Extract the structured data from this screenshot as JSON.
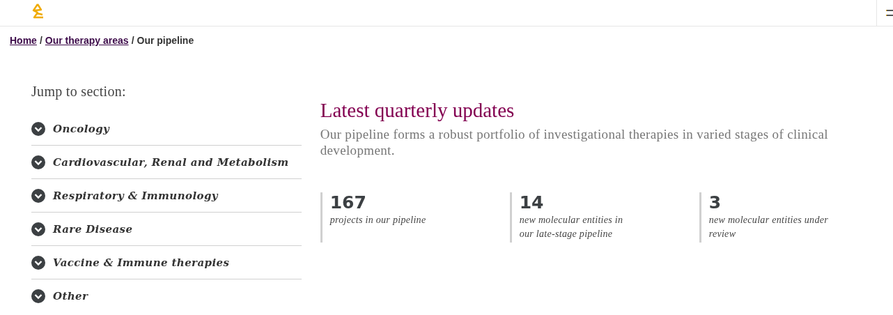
{
  "breadcrumb": [
    {
      "kind": "link",
      "label": "Home"
    },
    {
      "kind": "separator",
      "label": "/"
    },
    {
      "kind": "link",
      "label": "Our therapy areas"
    },
    {
      "kind": "separator",
      "label": "/"
    },
    {
      "kind": "current",
      "label": "Our pipeline"
    }
  ],
  "sidebar": {
    "title": "Jump to section:",
    "items": [
      {
        "label": "Oncology",
        "expanded": false
      },
      {
        "label": "Cardiovascular, Renal and Metabolism",
        "expanded": false
      },
      {
        "label": "Respiratory & Immunology",
        "expanded": false
      },
      {
        "label": "Rare Disease",
        "expanded": false
      },
      {
        "label": "Vaccine & Immune therapies",
        "expanded": false
      },
      {
        "label": "Other",
        "expanded": false
      }
    ]
  },
  "main": {
    "title": "Latest quarterly updates",
    "intro": "Our pipeline forms a robust portfolio of investigational therapies in varied stages of clinical development.",
    "stats": [
      {
        "value": "167",
        "label": "projects in our pipeline"
      },
      {
        "value": "14",
        "label": "new molecular entities in our late-stage pipeline"
      },
      {
        "value": "3",
        "label": "new molecular entities under review"
      }
    ]
  }
}
